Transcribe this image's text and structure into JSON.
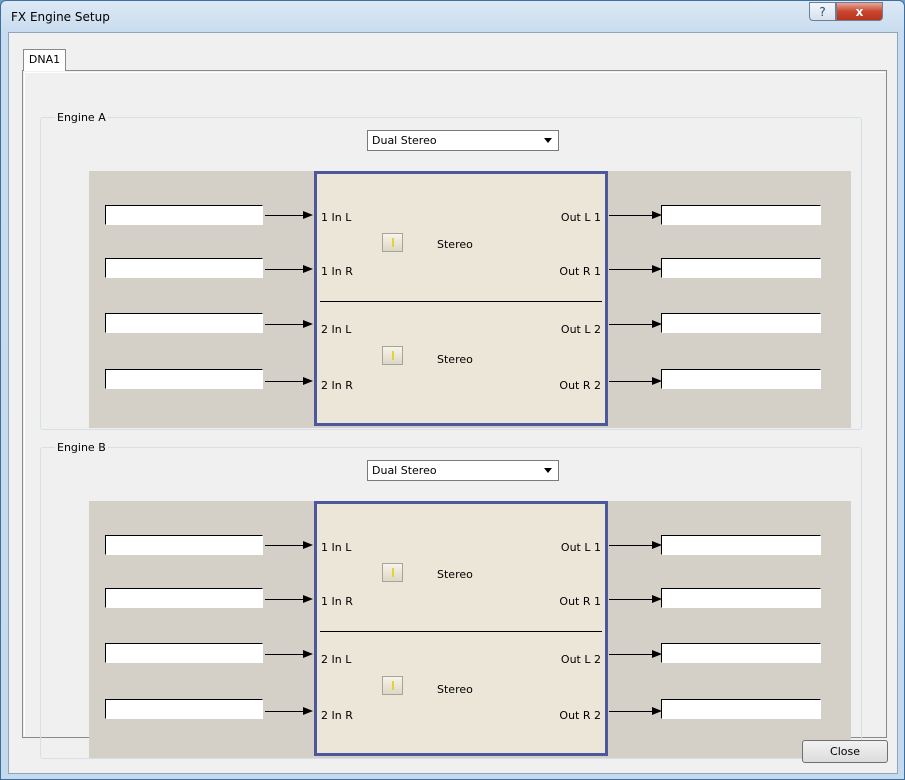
{
  "window": {
    "title": "FX Engine Setup",
    "help_label": "?",
    "close_label": "x"
  },
  "tabs": [
    {
      "label": "DNA1"
    }
  ],
  "engines": [
    {
      "label": "Engine A",
      "mode": "Dual Stereo",
      "pairs": [
        {
          "in_top": "1 In L",
          "in_bottom": "1 In R",
          "out_top": "Out L 1",
          "out_bottom": "Out R 1",
          "mode": "Stereo"
        },
        {
          "in_top": "2 In L",
          "in_bottom": "2 In R",
          "out_top": "Out L 2",
          "out_bottom": "Out R 2",
          "mode": "Stereo"
        }
      ]
    },
    {
      "label": "Engine B",
      "mode": "Dual Stereo",
      "pairs": [
        {
          "in_top": "1 In L",
          "in_bottom": "1 In R",
          "out_top": "Out L 1",
          "out_bottom": "Out R 1",
          "mode": "Stereo"
        },
        {
          "in_top": "2 In L",
          "in_bottom": "2 In R",
          "out_top": "Out L 2",
          "out_bottom": "Out R 2",
          "mode": "Stereo"
        }
      ]
    }
  ],
  "footer": {
    "close_label": "Close"
  },
  "colors": {
    "accent": "#4d579e",
    "routing_bg": "#d4d0c8",
    "fx_bg": "#ebe6d8"
  }
}
